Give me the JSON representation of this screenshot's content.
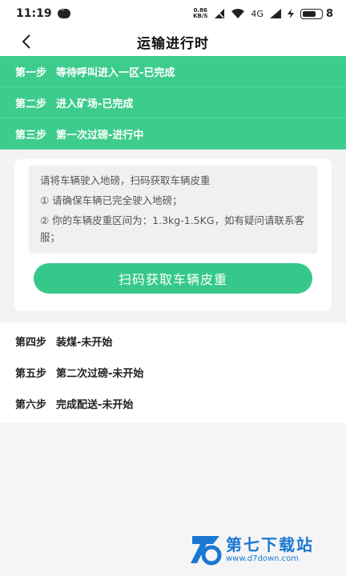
{
  "status": {
    "time": "11:19",
    "net_speed_value": "0.86",
    "net_speed_unit": "KB/S",
    "signal_label": "4G",
    "battery": "8"
  },
  "nav": {
    "title": "运输进行时"
  },
  "steps_done": [
    {
      "no": "第一步",
      "text": "等待呼叫进入一区-已完成"
    },
    {
      "no": "第二步",
      "text": "进入矿场-已完成"
    },
    {
      "no": "第三步",
      "text": "第一次过磅-进行中"
    }
  ],
  "card": {
    "intro": "请将车辆驶入地磅，扫码获取车辆皮重",
    "tip1": "① 请确保车辆已完全驶入地磅；",
    "tip2": "② 你的车辆皮重区间为：1.3kg-1.5KG，如有疑问请联系客服；",
    "scan_button": "扫码获取车辆皮重"
  },
  "steps_pending": [
    {
      "no": "第四步",
      "text": "装煤-未开始"
    },
    {
      "no": "第五步",
      "text": "第二次过磅-未开始"
    },
    {
      "no": "第六步",
      "text": "完成配送-未开始"
    }
  ],
  "watermark": {
    "brand": "第七下载站",
    "url": "www.d7down.com"
  },
  "colors": {
    "accent": "#3dcc8c",
    "button": "#35c88a",
    "watermark": "#1a78d4"
  }
}
